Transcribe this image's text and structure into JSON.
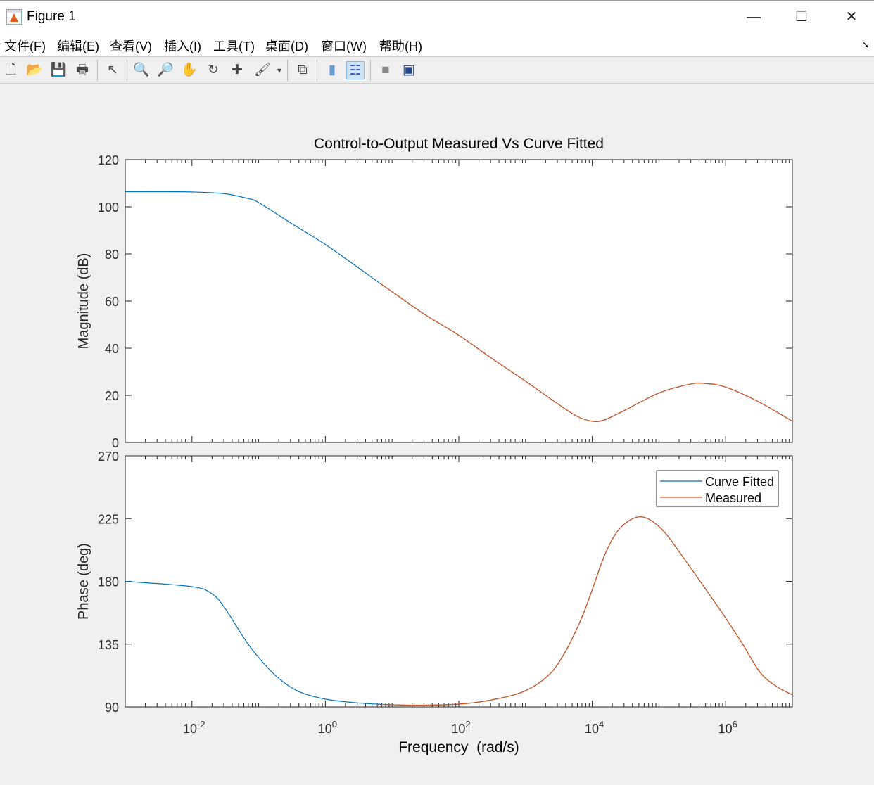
{
  "window": {
    "title": "Figure 1",
    "minimize": "—",
    "maximize": "☐",
    "close": "✕"
  },
  "menu": [
    "文件(F)",
    "编辑(E)",
    "查看(V)",
    "插入(I)",
    "工具(T)",
    "桌面(D)",
    "窗口(W)",
    "帮助(H)"
  ],
  "toolbar": [
    {
      "name": "new-figure-icon",
      "glyph": "🗋"
    },
    {
      "name": "open-file-icon",
      "glyph": "📂"
    },
    {
      "name": "save-icon",
      "glyph": "💾"
    },
    {
      "name": "print-icon",
      "glyph": "🖶"
    },
    {
      "name": "pointer-icon",
      "glyph": "↖"
    },
    {
      "name": "zoom-in-icon",
      "glyph": "🔍"
    },
    {
      "name": "zoom-out-icon",
      "glyph": "🔎"
    },
    {
      "name": "pan-hand-icon",
      "glyph": "✋"
    },
    {
      "name": "rotate-3d-icon",
      "glyph": "↻"
    },
    {
      "name": "data-cursor-icon",
      "glyph": "✚"
    },
    {
      "name": "brush-icon",
      "glyph": "🖌"
    },
    {
      "name": "brush-dropdown-icon",
      "glyph": "▾"
    },
    {
      "name": "link-plot-icon",
      "glyph": "⧉"
    },
    {
      "name": "colorbar-icon",
      "glyph": "▮"
    },
    {
      "name": "legend-icon",
      "glyph": "☷"
    },
    {
      "name": "hide-plot-tools-icon",
      "glyph": "■"
    },
    {
      "name": "show-plot-tools-icon",
      "glyph": "▣"
    }
  ],
  "chart_data": [
    {
      "type": "line",
      "title": "Control-to-Output Measured Vs Curve Fitted",
      "ylabel": "Magnitude (dB)",
      "xlabel": "",
      "xscale": "log",
      "xlim": [
        0.001,
        10000000
      ],
      "ylim": [
        0,
        120
      ],
      "yticks": [
        0,
        20,
        40,
        60,
        80,
        100,
        120
      ],
      "series": [
        {
          "name": "Curve Fitted",
          "color": "#0072BD",
          "x": [
            0.001,
            0.003,
            0.01,
            0.03,
            0.065,
            0.1,
            0.3,
            1,
            3,
            6.6,
            10,
            30,
            100,
            300,
            1000,
            3000,
            6000,
            10000,
            15000,
            30000,
            100000,
            300000,
            500000,
            1000000,
            3000000,
            10000000
          ],
          "y": [
            106.4,
            106.4,
            106.3,
            105.6,
            103.7,
            101.8,
            93.2,
            84,
            74.5,
            67.5,
            64,
            54.5,
            45.5,
            36,
            26,
            16.5,
            11,
            9,
            9.5,
            13.5,
            21,
            24.8,
            25,
            23.5,
            17.5,
            9
          ]
        },
        {
          "name": "Measured",
          "color": "#D95319",
          "x": [
            6.6,
            10,
            30,
            100,
            300,
            1000,
            3000,
            6000,
            10000,
            15000,
            30000,
            100000,
            300000,
            500000,
            1000000,
            3000000,
            10000000
          ],
          "y": [
            67.5,
            64,
            54.5,
            45.5,
            36,
            26,
            16.5,
            11,
            9,
            9.5,
            13.5,
            21,
            24.8,
            25,
            23.5,
            17.5,
            9
          ]
        }
      ]
    },
    {
      "type": "line",
      "title": "",
      "ylabel": "Phase (deg)",
      "xlabel": "Frequency  (rad/s)",
      "xscale": "log",
      "xlim": [
        0.001,
        10000000
      ],
      "ylim": [
        90,
        270
      ],
      "yticks": [
        90,
        135,
        180,
        225,
        270
      ],
      "xticks": [
        {
          "base": "10",
          "exp": "-2"
        },
        {
          "base": "10",
          "exp": "0"
        },
        {
          "base": "10",
          "exp": "2"
        },
        {
          "base": "10",
          "exp": "4"
        },
        {
          "base": "10",
          "exp": "6"
        }
      ],
      "legend": {
        "location": "top-right",
        "entries": [
          "Curve Fitted",
          "Measured"
        ]
      },
      "series": [
        {
          "name": "Curve Fitted",
          "color": "#0072BD",
          "x": [
            0.001,
            0.01,
            0.02,
            0.031,
            0.059,
            0.095,
            0.19,
            0.4,
            1,
            2.8,
            9.3,
            26,
            100,
            280,
            930,
            2240,
            4000,
            6900,
            10000,
            15600,
            26000,
            52500,
            107000,
            225000,
            630000,
            1000000,
            1800000,
            3300000,
            5900000,
            10000000
          ],
          "y": [
            180,
            176.2,
            171,
            161,
            140,
            126.6,
            111.4,
            101,
            95.6,
            93,
            91.6,
            91.2,
            92,
            94.6,
            101,
            113,
            130,
            153.6,
            174,
            199.6,
            218,
            226.3,
            218,
            198,
            167.6,
            153.7,
            135,
            114.6,
            104.4,
            98.7
          ]
        },
        {
          "name": "Measured",
          "color": "#D95319",
          "x": [
            5.9,
            9.3,
            26,
            100,
            280,
            930,
            2240,
            4000,
            6900,
            10000,
            15600,
            26000,
            52500,
            107000,
            225000,
            630000,
            1000000,
            1800000,
            3300000,
            5900000,
            10000000
          ],
          "y": [
            91.8,
            91.6,
            91.2,
            92,
            94.6,
            101,
            113,
            130,
            153.6,
            174,
            199.6,
            218,
            226.3,
            218,
            198,
            167.6,
            153.7,
            135,
            114.6,
            104.4,
            98.7
          ]
        }
      ]
    }
  ]
}
